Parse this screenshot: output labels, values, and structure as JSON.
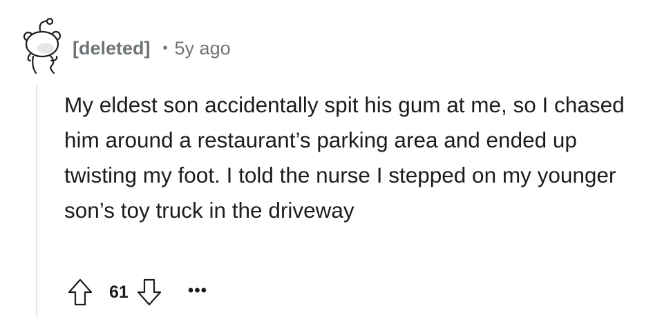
{
  "comment": {
    "author": "[deleted]",
    "separator": "•",
    "timestamp": "5y ago",
    "body": "My eldest son accidentally spit his gum at me, so I chased him around a restaurant’s parking area and ended up twisting my foot. I told the nurse I stepped on my younger son’s toy truck in the driveway",
    "score": "61",
    "more_label": "•••"
  },
  "icons": {
    "avatar": "deleted-user-snoo-icon",
    "upvote": "upvote-arrow-icon",
    "downvote": "downvote-arrow-icon",
    "more": "more-options-icon"
  },
  "colors": {
    "meta_text": "#6f7478",
    "body_text": "#1c1c1c",
    "thread_line": "#e5e7e9"
  }
}
